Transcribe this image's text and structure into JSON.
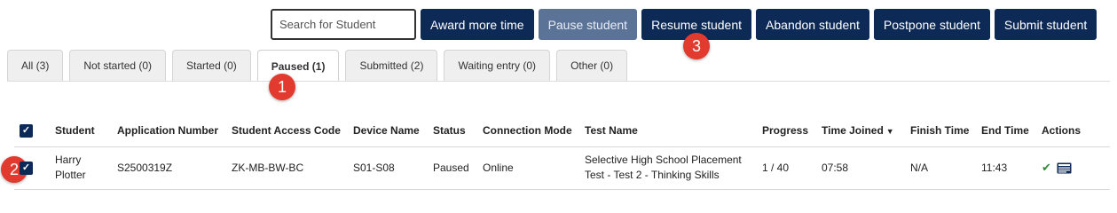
{
  "toolbar": {
    "search_placeholder": "Search for Student",
    "buttons": [
      {
        "label": "Award more time"
      },
      {
        "label": "Pause student"
      },
      {
        "label": "Resume student"
      },
      {
        "label": "Abandon student"
      },
      {
        "label": "Postpone student"
      },
      {
        "label": "Submit student"
      }
    ]
  },
  "tabs": [
    {
      "label": "All (3)"
    },
    {
      "label": "Not started (0)"
    },
    {
      "label": "Started (0)"
    },
    {
      "label": "Paused (1)",
      "active": true
    },
    {
      "label": "Submitted (2)"
    },
    {
      "label": "Waiting entry (0)"
    },
    {
      "label": "Other (0)"
    }
  ],
  "markers": [
    "1",
    "2",
    "3"
  ],
  "table": {
    "headers": {
      "student": "Student",
      "application_number": "Application Number",
      "access_code": "Student Access Code",
      "device_name": "Device Name",
      "status": "Status",
      "connection_mode": "Connection Mode",
      "test_name": "Test Name",
      "progress": "Progress",
      "time_joined": "Time Joined",
      "finish_time": "Finish Time",
      "end_time": "End Time",
      "actions": "Actions"
    },
    "rows": [
      {
        "student": "Harry Plotter",
        "application_number": "S2500319Z",
        "access_code": "ZK-MB-BW-BC",
        "device_name": "S01-S08",
        "status": "Paused",
        "connection_mode": "Online",
        "test_name": "Selective High School Placement Test - Test 2 - Thinking Skills",
        "progress": "1 / 40",
        "time_joined": "07:58",
        "finish_time": "N/A",
        "end_time": "11:43"
      }
    ]
  },
  "colors": {
    "primary": "#0d2a57",
    "disabled": "#5a7396",
    "marker": "#e23a2e",
    "check": "#2e8b3b"
  },
  "icons": [
    "checkmark-icon",
    "details-icon",
    "sort-down-icon"
  ]
}
